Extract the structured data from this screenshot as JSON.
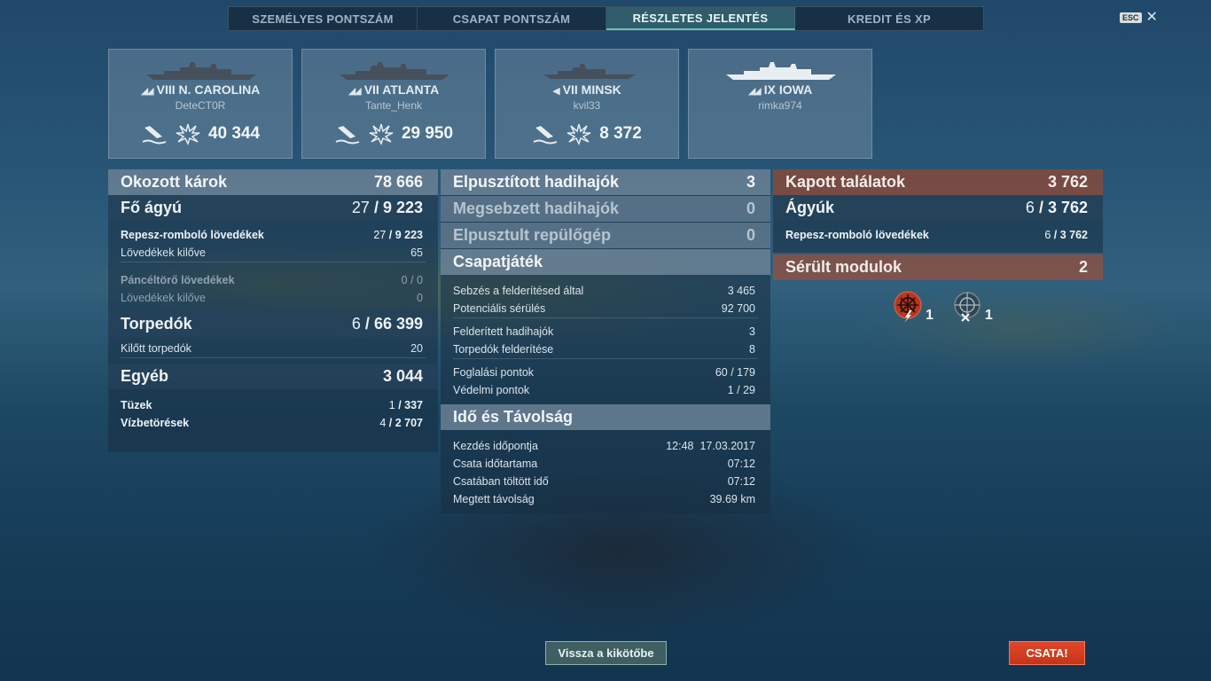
{
  "tabs": [
    {
      "label": "SZEMÉLYES PONTSZÁM"
    },
    {
      "label": "CSAPAT PONTSZÁM"
    },
    {
      "label": "RÉSZLETES JELENTÉS"
    },
    {
      "label": "KREDIT ÉS XP"
    }
  ],
  "esc": {
    "key": "ESC",
    "close": "✕"
  },
  "cards": [
    {
      "name": "VIII N. CAROLINA",
      "player": "DeteCT0R",
      "damage": "40 344"
    },
    {
      "name": "VII ATLANTA",
      "player": "Tante_Henk",
      "damage": "29 950"
    },
    {
      "name": "VII MINSK",
      "player": "kvil33",
      "damage": "8 372"
    },
    {
      "name": "IX IOWA",
      "player": "rimka974"
    }
  ],
  "left": {
    "damage_dealt": {
      "label": "Okozott károk",
      "value": "78 666"
    },
    "main_battery": {
      "label": "Fő ágyú",
      "hits": "27",
      "value": "9 223"
    },
    "he": {
      "label": "Repesz-romboló lövedékek",
      "hits": "27",
      "value": "9 223"
    },
    "he_fired": {
      "label": "Lövedékek kilőve",
      "value": "65"
    },
    "ap": {
      "label": "Páncéltörő lövedékek",
      "value": "0 / 0"
    },
    "ap_fired": {
      "label": "Lövedékek kilőve",
      "value": "0"
    },
    "torpedoes": {
      "label": "Torpedók",
      "hits": "6",
      "value": "66 399"
    },
    "torp_fired": {
      "label": "Kilőtt torpedók",
      "value": "20"
    },
    "other": {
      "label": "Egyéb",
      "value": "3 044"
    },
    "fires": {
      "label": "Tüzek",
      "hits": "1",
      "value": "337"
    },
    "floods": {
      "label": "Vízbetörések",
      "hits": "4",
      "value": "2 707"
    }
  },
  "middle": {
    "destroyed": {
      "label": "Elpusztított hadihajók",
      "value": "3"
    },
    "damaged": {
      "label": "Megsebzett hadihajók",
      "value": "0"
    },
    "planes": {
      "label": "Elpusztult repülőgép",
      "value": "0"
    },
    "teamplay": {
      "label": "Csapatjáték"
    },
    "spot_dmg": {
      "label": "Sebzés a felderítésed által",
      "value": "3 465"
    },
    "potential": {
      "label": "Potenciális sérülés",
      "value": "92 700"
    },
    "spotted": {
      "label": "Felderített hadihajók",
      "value": "3"
    },
    "torp_spot": {
      "label": "Torpedók felderítése",
      "value": "8"
    },
    "capture": {
      "label": "Foglalási pontok",
      "value": "60 / 179"
    },
    "defense": {
      "label": "Védelmi pontok",
      "value": "1 / 29"
    },
    "time_hdr": {
      "label": "Idő és Távolság"
    },
    "start": {
      "label": "Kezdés időpontja",
      "time": "12:48",
      "date": "17.03.2017"
    },
    "duration": {
      "label": "Csata időtartama",
      "value": "07:12"
    },
    "in_battle": {
      "label": "Csatában töltött idő",
      "value": "07:12"
    },
    "distance": {
      "label": "Megtett távolság",
      "value": "39.69 km"
    }
  },
  "right": {
    "received": {
      "label": "Kapott találatok",
      "value": "3 762"
    },
    "guns": {
      "label": "Ágyúk",
      "hits": "6",
      "value": "3 762"
    },
    "he": {
      "label": "Repesz-romboló lövedékek",
      "hits": "6",
      "value": "3 762"
    },
    "modules": {
      "label": "Sérült modulok",
      "value": "2"
    },
    "module_items": [
      {
        "icon": "steering-gear-damaged-icon",
        "count": "1"
      },
      {
        "icon": "fire-control-destroyed-icon",
        "count": "1"
      }
    ]
  },
  "buttons": {
    "back": "Vissza a kikötőbe",
    "battle": "CSATA!"
  },
  "colors": {
    "accent_tab": "#5fc6c0",
    "battle_btn": "#d43e22",
    "received_hdr": "#96503e"
  }
}
